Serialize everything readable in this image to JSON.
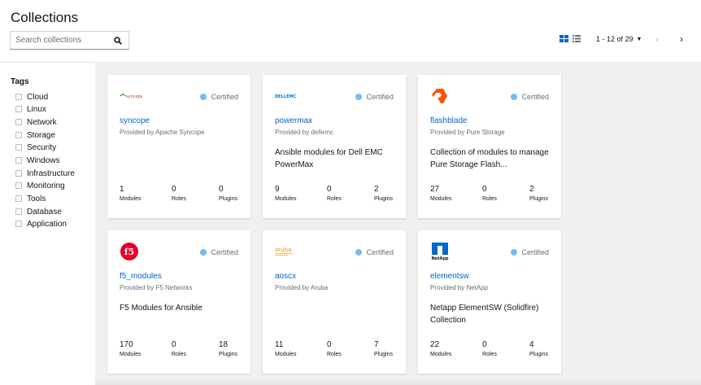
{
  "header": {
    "title": "Collections",
    "search": {
      "placeholder": "Search collections",
      "value": ""
    },
    "pagination": {
      "range": "1 - 12 of 29"
    }
  },
  "sidebar": {
    "title": "Tags",
    "tags": [
      "Cloud",
      "Linux",
      "Network",
      "Storage",
      "Security",
      "Windows",
      "Infrastructure",
      "Monitoring",
      "Tools",
      "Database",
      "Application"
    ]
  },
  "labels": {
    "certified": "Certified",
    "modules": "Modules",
    "roles": "Roles",
    "plugins": "Plugins"
  },
  "colors": {
    "link": "#0066cc",
    "certified_dot": "#73bcf7",
    "background": "#f0f0f0"
  },
  "cards": [
    {
      "name": "syncope",
      "provider": "Provided by Apache Syncope",
      "description": "",
      "modules": "1",
      "roles": "0",
      "plugins": "0",
      "logo": "syncope-logo",
      "logo_text": "syncope"
    },
    {
      "name": "powermax",
      "provider": "Provided by dellemc",
      "description": "Ansible modules for Dell EMC PowerMax",
      "modules": "9",
      "roles": "0",
      "plugins": "2",
      "logo": "dellemc-logo",
      "logo_text": "DELLEMC"
    },
    {
      "name": "flashblade",
      "provider": "Provided by Pure Storage",
      "description": "Collection of modules to manage Pure Storage Flash...",
      "modules": "27",
      "roles": "0",
      "plugins": "2",
      "logo": "pure-storage-logo",
      "logo_text": ""
    },
    {
      "name": "f5_modules",
      "provider": "Provided by F5 Networks",
      "description": "F5 Modules for Ansible",
      "modules": "170",
      "roles": "0",
      "plugins": "18",
      "logo": "f5-logo",
      "logo_text": "f5"
    },
    {
      "name": "aoscx",
      "provider": "Provided by Aruba",
      "description": "",
      "modules": "11",
      "roles": "0",
      "plugins": "7",
      "logo": "aruba-logo",
      "logo_text": "aruba"
    },
    {
      "name": "elementsw",
      "provider": "Provided by NetApp",
      "description": "Netapp ElementSW (Solidfire) Collection",
      "modules": "22",
      "roles": "0",
      "plugins": "4",
      "logo": "netapp-logo",
      "logo_text": "NetApp"
    }
  ]
}
